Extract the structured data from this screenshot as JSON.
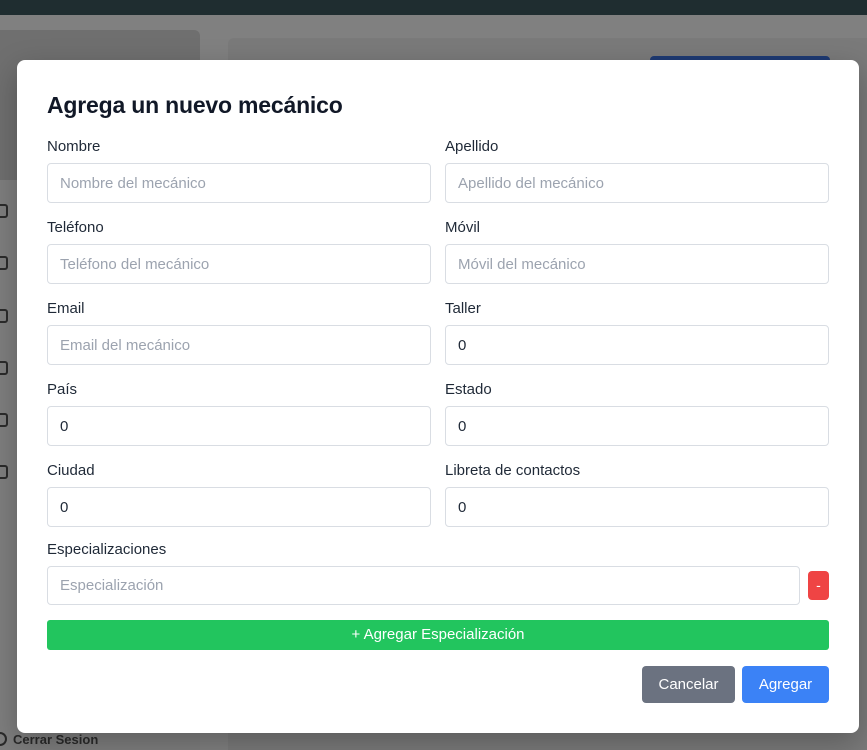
{
  "background": {
    "logout_label": "Cerrar Sesion"
  },
  "modal": {
    "title": "Agrega un nuevo mecánico",
    "fields": {
      "nombre": {
        "label": "Nombre",
        "placeholder": "Nombre del mecánico",
        "value": ""
      },
      "apellido": {
        "label": "Apellido",
        "placeholder": "Apellido del mecánico",
        "value": ""
      },
      "telefono": {
        "label": "Teléfono",
        "placeholder": "Teléfono del mecánico",
        "value": ""
      },
      "movil": {
        "label": "Móvil",
        "placeholder": "Móvil del mecánico",
        "value": ""
      },
      "email": {
        "label": "Email",
        "placeholder": "Email del mecánico",
        "value": ""
      },
      "taller": {
        "label": "Taller",
        "value": "0"
      },
      "pais": {
        "label": "País",
        "value": "0"
      },
      "estado": {
        "label": "Estado",
        "value": "0"
      },
      "ciudad": {
        "label": "Ciudad",
        "value": "0"
      },
      "libreta": {
        "label": "Libreta de contactos",
        "value": "0"
      }
    },
    "especializaciones": {
      "label": "Especializaciones",
      "placeholder": "Especialización",
      "remove_label": "-",
      "add_label": "+ Agregar Especialización"
    },
    "buttons": {
      "cancel": "Cancelar",
      "submit": "Agregar"
    }
  },
  "colors": {
    "success": "#22c55e",
    "danger": "#ef4444",
    "primary": "#3b82f6",
    "secondary": "#6b7280"
  }
}
